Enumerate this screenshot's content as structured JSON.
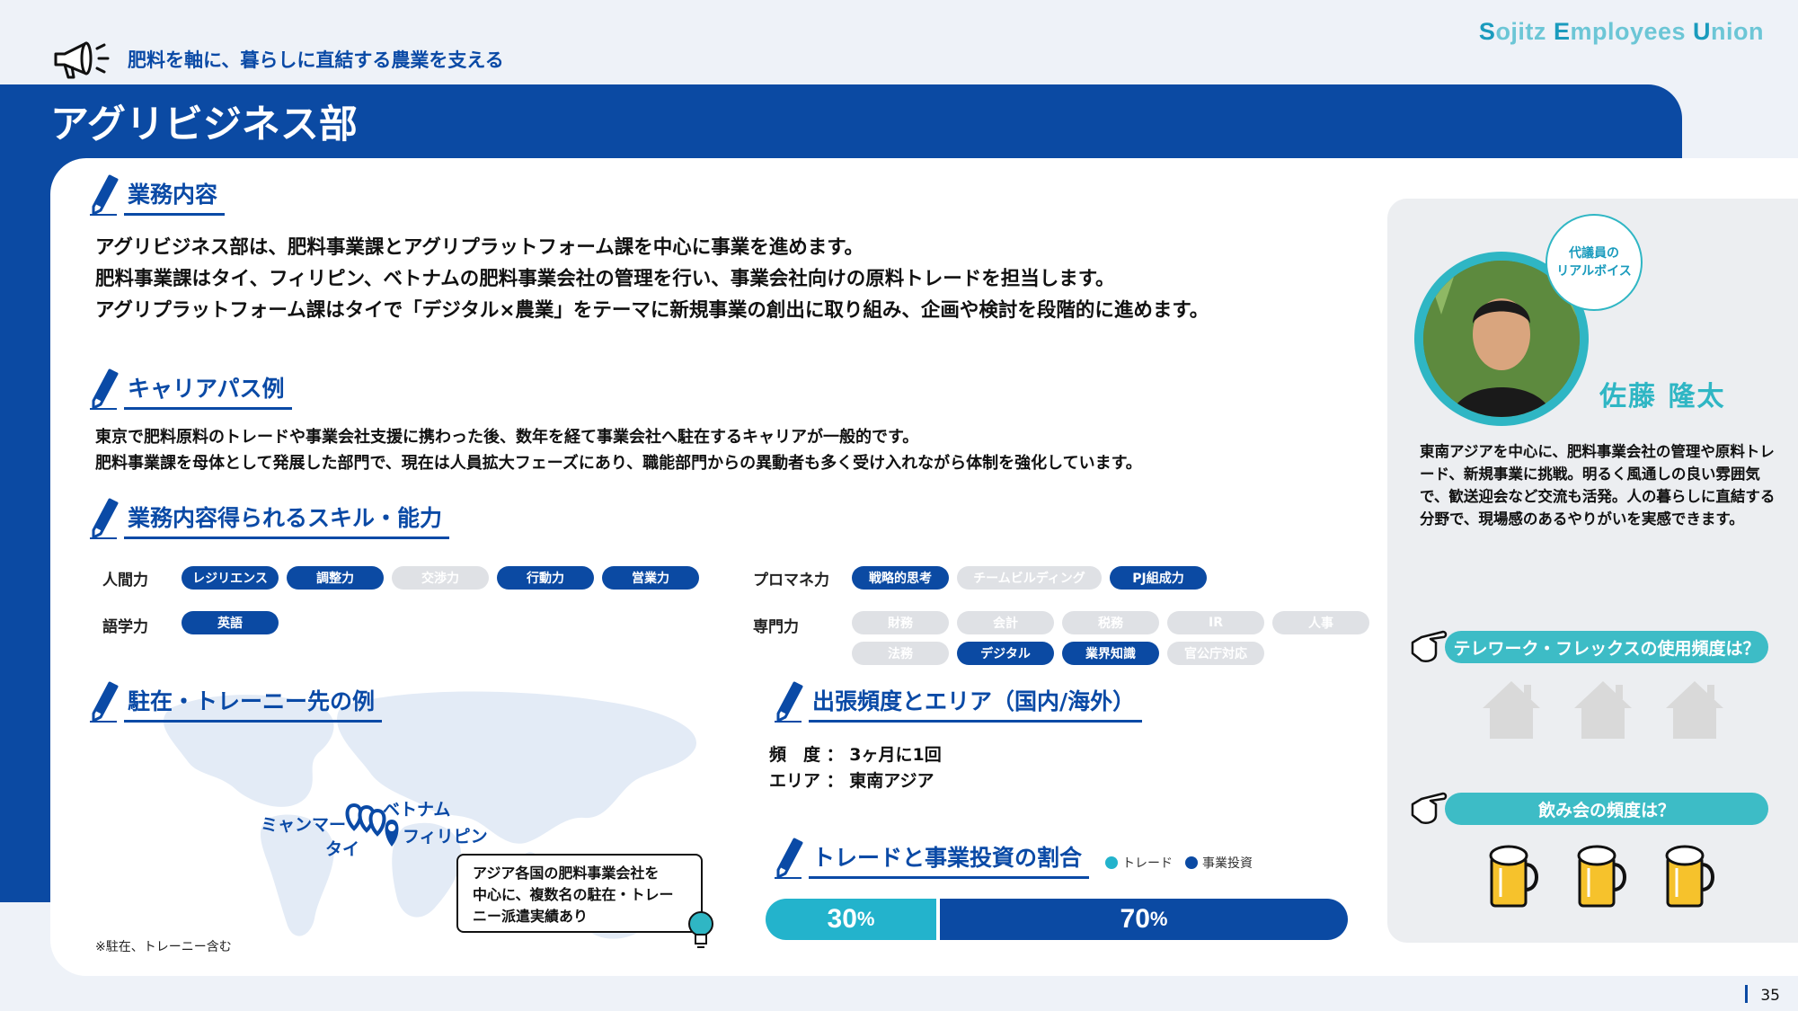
{
  "brand": {
    "s": "S",
    "ojitz": "ojitz ",
    "e": "E",
    "mployees": "mployees ",
    "u": "U",
    "nion": "nion"
  },
  "header": {
    "tagline": "肥料を軸に、暮らしに直結する農業を支える",
    "title": "アグリビジネス部"
  },
  "business": {
    "heading": "業務内容",
    "lines": [
      "アグリビジネス部は、肥料事業課とアグリプラットフォーム課を中心に事業を進めます。",
      "肥料事業課はタイ、フィリピン、ベトナムの肥料事業会社の管理を行い、事業会社向けの原料トレードを担当します。",
      "アグリプラットフォーム課はタイで「デジタル×農業」をテーマに新規事業の創出に取り組み、企画や検討を段階的に進めます。"
    ]
  },
  "career": {
    "heading": "キャリアパス例",
    "lines": [
      "東京で肥料原料のトレードや事業会社支援に携わった後、数年を経て事業会社へ駐在するキャリアが一般的です。",
      "肥料事業課を母体として発展した部門で、現在は人員拡大フェーズにあり、職能部門からの異動者も多く受け入れながら体制を強化しています。"
    ]
  },
  "skills": {
    "heading": "業務内容得られるスキル・能力",
    "groups": [
      {
        "label": "人間力",
        "items": [
          {
            "text": "レジリエンス",
            "on": true
          },
          {
            "text": "調整力",
            "on": true
          },
          {
            "text": "交渉力",
            "on": false
          },
          {
            "text": "行動力",
            "on": true
          },
          {
            "text": "営業力",
            "on": true
          }
        ]
      },
      {
        "label": "語学力",
        "items": [
          {
            "text": "英語",
            "on": true
          }
        ]
      },
      {
        "label": "プロマネ力",
        "items": [
          {
            "text": "戦略的思考",
            "on": true
          },
          {
            "text": "チームビルディング",
            "on": false
          },
          {
            "text": "PJ組成力",
            "on": true
          }
        ]
      },
      {
        "label": "専門力",
        "items": [
          {
            "text": "財務",
            "on": false
          },
          {
            "text": "会計",
            "on": false
          },
          {
            "text": "税務",
            "on": false
          },
          {
            "text": "IR",
            "on": false
          },
          {
            "text": "人事",
            "on": false
          },
          {
            "text": "法務",
            "on": false
          },
          {
            "text": "デジタル",
            "on": true
          },
          {
            "text": "業界知識",
            "on": true
          },
          {
            "text": "官公庁対応",
            "on": false
          }
        ]
      }
    ]
  },
  "assignment": {
    "heading": "駐在・トレーニー先の例",
    "places": [
      "ミャンマー",
      "タイ",
      "ベトナム",
      "フィリピン"
    ],
    "callout": [
      "アジア各国の肥料事業会社を",
      "中心に、複数名の駐在・トレー",
      "ニー派遣実績あり"
    ],
    "note": "※駐在、トレーニー含む"
  },
  "travel": {
    "heading": "出張頻度とエリア（国内/海外）",
    "freq_label": "頻　度",
    "freq_value": "3ヶ月に1回",
    "area_label": "エリア",
    "area_value": "東南アジア",
    "sep": "："
  },
  "ratio": {
    "heading": "トレードと事業投資の割合",
    "legend_trade": "トレード",
    "legend_invest": "事業投資",
    "trade_value": "30",
    "invest_value": "70",
    "unit": "%",
    "trade_fraction": 0.3,
    "invest_fraction": 0.7,
    "colors": {
      "trade": "#23b3cc",
      "invest": "#0b4aa3"
    }
  },
  "rep": {
    "bubble_l1": "代議員の",
    "bubble_l2": "リアルボイス",
    "name": "佐藤 隆太",
    "desc": "東南アジアを中心に、肥料事業会社の管理や原料トレード、新規事業に挑戦。明るく風通しの良い雰囲気で、歓送迎会など交流も活発。人の暮らしに直結する分野で、現場感のあるやりがいを実感できます。"
  },
  "telework": {
    "question": "テレワーク・フレックスの使用頻度は？",
    "level": 0,
    "max": 3
  },
  "drinks": {
    "question": "飲み会の頻度は？",
    "level": 3,
    "max": 3
  },
  "page": {
    "number": "35"
  },
  "colors": {
    "primary": "#0b4aa3",
    "accent": "#2fb6c4",
    "brand": "#6cc6d6"
  }
}
